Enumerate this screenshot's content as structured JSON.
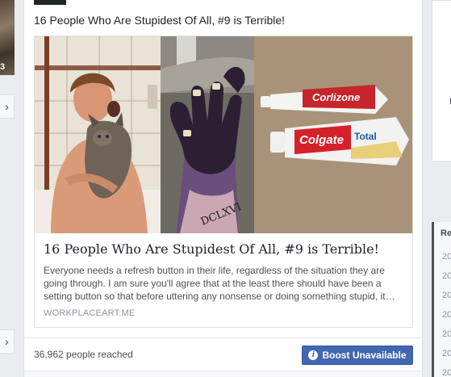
{
  "left": {
    "thumb_number": "3",
    "chevron_top": "›",
    "chevron_bottom": "›"
  },
  "post": {
    "text": "16 People Who Are Stupidest Of All, #9 is Terrible!",
    "link": {
      "title": "16 People Who Are Stupidest Of All, #9 is Terrible!",
      "description": "Everyone needs a refresh button in their life, regardless of the situation they are going through. I am sure you'll agree that at the least there should have been a setting button so that before uttering any nonsense or doing something stupid, it…",
      "domain": "WORKPLACEART.ME",
      "images": {
        "wrist_tattoo": "DCLXVI",
        "tube_top_brand": "Corlizone",
        "tube_bottom_brand": "Colgate",
        "tube_bottom_sub": "Total"
      }
    },
    "reach": "36,962 people reached",
    "boost_label": "Boost Unavailable",
    "boost_icon": "info-icon",
    "colors": {
      "boost": "#4267b2",
      "meta": "#90949c"
    }
  },
  "right": {
    "top_letter": "F",
    "tab_label": "Re",
    "years": [
      "20",
      "20",
      "20",
      "20",
      "20",
      "20",
      "20"
    ]
  }
}
